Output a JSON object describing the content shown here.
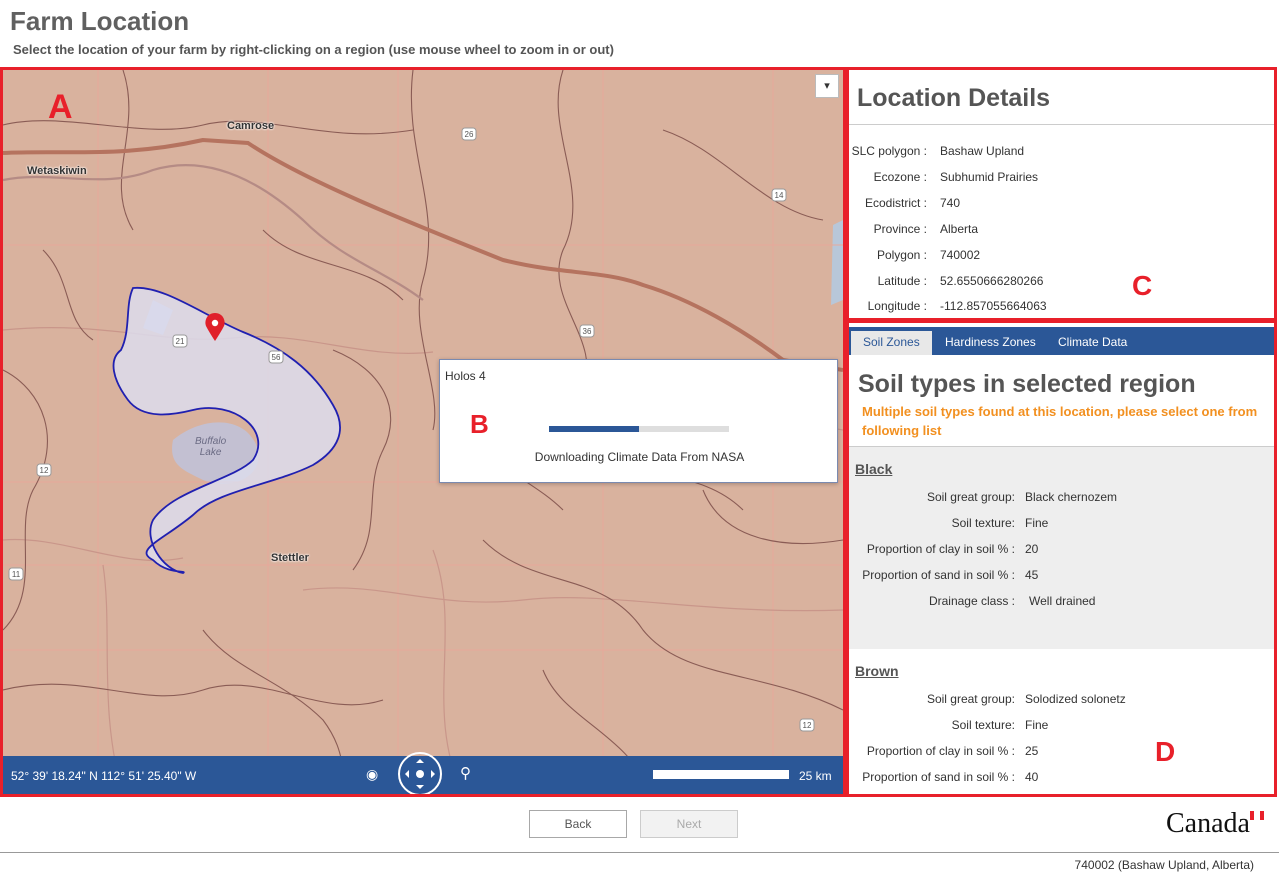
{
  "header": {
    "title": "Farm Location",
    "subtitle": "Select the location of your farm by right-clicking on a region (use mouse wheel to zoom in or out)"
  },
  "map": {
    "region_letter": "A",
    "labels": {
      "camrose": "Camrose",
      "wetaskiwin": "Wetaskiwin",
      "stettler": "Stettler",
      "buffalo_lake": "Buffalo\nLake"
    },
    "highway_shields": [
      "26",
      "14",
      "36",
      "21",
      "56",
      "12",
      "11",
      "12"
    ],
    "statusbar": {
      "coordinates": "52° 39' 18.24\" N 112° 51' 25.40\" W",
      "scale_label": "25 km"
    },
    "layer_toggle_icon": "chevron-down-icon"
  },
  "dialog": {
    "title": "Holos 4",
    "region_letter": "B",
    "progress_fraction": 0.5,
    "status": "Downloading Climate Data From NASA"
  },
  "location_details": {
    "title": "Location Details",
    "region_letter": "C",
    "rows": [
      {
        "key": "SLC polygon :",
        "value": "Bashaw Upland"
      },
      {
        "key": "Ecozone :",
        "value": "Subhumid Prairies"
      },
      {
        "key": "Ecodistrict :",
        "value": "740"
      },
      {
        "key": "Province :",
        "value": "Alberta"
      },
      {
        "key": "Polygon :",
        "value": "740002"
      },
      {
        "key": "Latitude :",
        "value": "52.6550666280266"
      },
      {
        "key": "Longitude :",
        "value": "-112.857055664063"
      }
    ]
  },
  "soil_panel": {
    "region_letter": "D",
    "tabs": [
      {
        "label": "Soil Zones",
        "active": true
      },
      {
        "label": "Hardiness Zones",
        "active": false
      },
      {
        "label": "Climate Data",
        "active": false
      }
    ],
    "heading": "Soil types in selected region",
    "warning_line1": "Multiple soil types found at this location, please select one from",
    "warning_line2": "following list",
    "soil_types": [
      {
        "name": "Black",
        "rows": [
          {
            "key": "Soil great group:",
            "value": "Black chernozem"
          },
          {
            "key": "Soil texture:",
            "value": "Fine"
          },
          {
            "key": "Proportion of clay in soil % :",
            "value": "20"
          },
          {
            "key": "Proportion of sand in soil % :",
            "value": "45"
          },
          {
            "key": "Drainage class :",
            "value": "Well drained"
          }
        ]
      },
      {
        "name": "Brown",
        "rows": [
          {
            "key": "Soil great group:",
            "value": "Solodized solonetz"
          },
          {
            "key": "Soil texture:",
            "value": "Fine"
          },
          {
            "key": "Proportion of clay in soil % :",
            "value": "25"
          },
          {
            "key": "Proportion of sand in soil % :",
            "value": "40"
          }
        ]
      }
    ]
  },
  "footer": {
    "back_label": "Back",
    "next_label": "Next",
    "wordmark": "Canada",
    "status": "740002 (Bashaw Upland, Alberta)"
  },
  "colors": {
    "accent_blue": "#2b5797",
    "annotation_red": "#e8202a",
    "warning_orange": "#f29020",
    "map_base": "#d9b29e"
  }
}
